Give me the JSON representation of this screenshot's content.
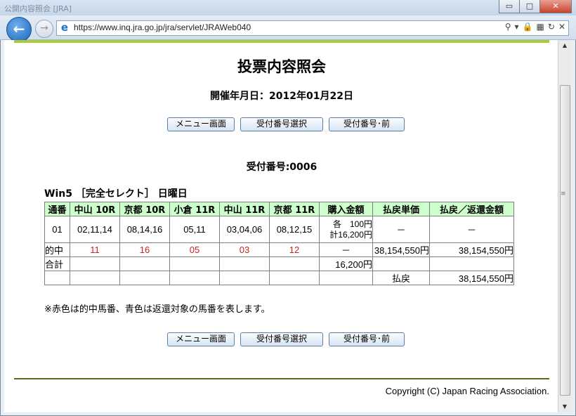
{
  "browser": {
    "title_blur": "公開内容照会 [JRA]",
    "url": "https://www.inq.jra.go.jp/jra/servlet/JRAWeb040",
    "window_buttons": [
      "▭",
      "□",
      "✕"
    ]
  },
  "page": {
    "title": "投票内容照会",
    "date_label": "開催年月日：2012年01月22日",
    "buttons": {
      "menu": "メニュー画面",
      "select": "受付番号選択",
      "prev": "受付番号･前"
    },
    "receipt_label": "受付番号:0006",
    "bet_kind": "Win5 ［完全セレクト］ 日曜日",
    "table": {
      "headers": [
        "通番",
        "中山 10R",
        "京都 10R",
        "小倉 11R",
        "中山 11R",
        "京都 11R",
        "購入金額",
        "払戻単価",
        "払戻／返還金額"
      ],
      "row1": {
        "no": "01",
        "r1": "02,11,14",
        "r2": "08,14,16",
        "r3": "05,11",
        "r4": "03,04,06",
        "r5": "08,12,15",
        "amount_line1": "各　100円",
        "amount_line2": "計16,200円",
        "unit": "－",
        "payout": "－"
      },
      "hit": {
        "label": "的中",
        "r1": "11",
        "r2": "16",
        "r3": "05",
        "r4": "03",
        "r5": "12",
        "amount": "－",
        "unit": "38,154,550円",
        "payout": "38,154,550円"
      },
      "total": {
        "label": "合計",
        "amount": "16,200円"
      },
      "refund": {
        "label": "払戻",
        "payout": "38,154,550円"
      }
    },
    "note": "※赤色は的中馬番、青色は返還対象の馬番を表します。",
    "copyright": "Copyright (C) Japan Racing Association."
  }
}
